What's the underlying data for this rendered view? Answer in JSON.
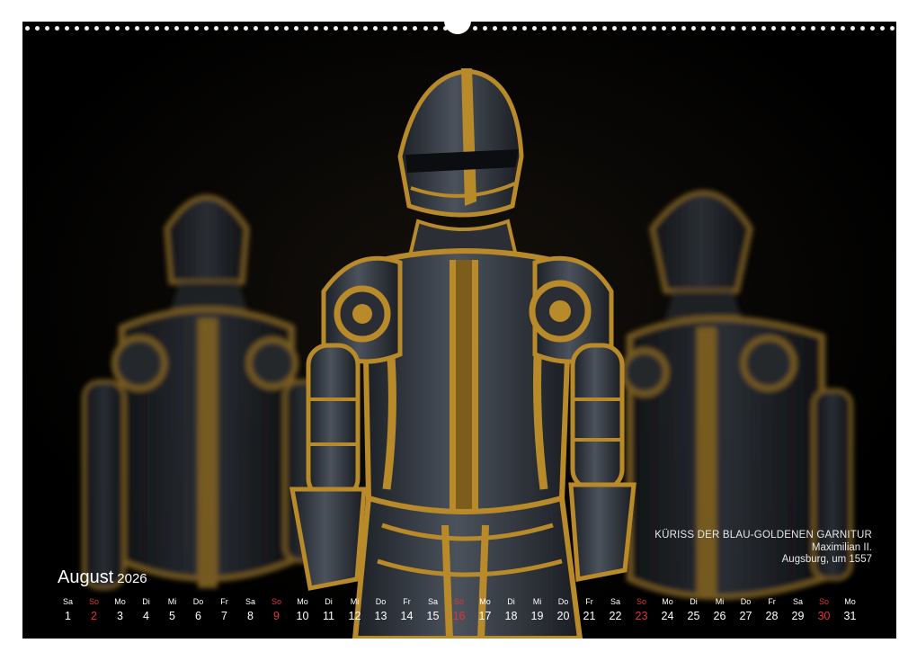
{
  "calendar": {
    "month": "August",
    "year": "2026",
    "days": [
      {
        "wd": "Sa",
        "d": "1",
        "sun": false
      },
      {
        "wd": "So",
        "d": "2",
        "sun": true
      },
      {
        "wd": "Mo",
        "d": "3",
        "sun": false
      },
      {
        "wd": "Di",
        "d": "4",
        "sun": false
      },
      {
        "wd": "Mi",
        "d": "5",
        "sun": false
      },
      {
        "wd": "Do",
        "d": "6",
        "sun": false
      },
      {
        "wd": "Fr",
        "d": "7",
        "sun": false
      },
      {
        "wd": "Sa",
        "d": "8",
        "sun": false
      },
      {
        "wd": "So",
        "d": "9",
        "sun": true
      },
      {
        "wd": "Mo",
        "d": "10",
        "sun": false
      },
      {
        "wd": "Di",
        "d": "11",
        "sun": false
      },
      {
        "wd": "Mi",
        "d": "12",
        "sun": false
      },
      {
        "wd": "Do",
        "d": "13",
        "sun": false
      },
      {
        "wd": "Fr",
        "d": "14",
        "sun": false
      },
      {
        "wd": "Sa",
        "d": "15",
        "sun": false
      },
      {
        "wd": "So",
        "d": "16",
        "sun": true
      },
      {
        "wd": "Mo",
        "d": "17",
        "sun": false
      },
      {
        "wd": "Di",
        "d": "18",
        "sun": false
      },
      {
        "wd": "Mi",
        "d": "19",
        "sun": false
      },
      {
        "wd": "Do",
        "d": "20",
        "sun": false
      },
      {
        "wd": "Fr",
        "d": "21",
        "sun": false
      },
      {
        "wd": "Sa",
        "d": "22",
        "sun": false
      },
      {
        "wd": "So",
        "d": "23",
        "sun": true
      },
      {
        "wd": "Mo",
        "d": "24",
        "sun": false
      },
      {
        "wd": "Di",
        "d": "25",
        "sun": false
      },
      {
        "wd": "Mi",
        "d": "26",
        "sun": false
      },
      {
        "wd": "Do",
        "d": "27",
        "sun": false
      },
      {
        "wd": "Fr",
        "d": "28",
        "sun": false
      },
      {
        "wd": "Sa",
        "d": "29",
        "sun": false
      },
      {
        "wd": "So",
        "d": "30",
        "sun": true
      },
      {
        "wd": "Mo",
        "d": "31",
        "sun": false
      }
    ]
  },
  "caption": {
    "title": "KÜRISS DER BLAU-GOLDENEN GARNITUR",
    "line2": "Maximilian II.",
    "line3": "Augsburg, um 1557"
  },
  "colors": {
    "background": "#000000",
    "text": "#ffffff",
    "sunday": "#e23434",
    "gold": "#b88a2a",
    "steel": "#3a4048"
  }
}
